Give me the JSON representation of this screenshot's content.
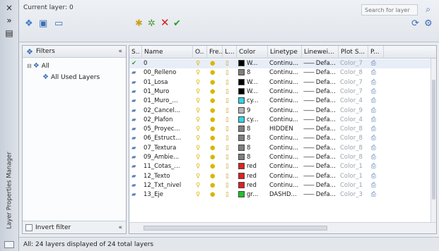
{
  "palette": {
    "title": "Layer Properties Manager"
  },
  "header": {
    "current_layer": "Current layer: 0",
    "search_placeholder": "Search for layer"
  },
  "filters": {
    "title": "Filters",
    "collapse_glyph": "«",
    "tree": [
      {
        "label": "All",
        "level": 0
      },
      {
        "label": "All Used Layers",
        "level": 1
      }
    ],
    "invert_filter_label": "Invert filter",
    "invert_filter_checked": false
  },
  "columns": [
    "S..",
    "Name",
    "O..",
    "Fre...",
    "L...",
    "Color",
    "Linetype",
    "Linewei...",
    "Plot S...",
    "P..."
  ],
  "layers": [
    {
      "name": "0",
      "color_name": "W...",
      "color_hex": "#000000",
      "linetype": "Continu...",
      "lineweight": "Defa...",
      "plot_style": "Color_7",
      "current": true
    },
    {
      "name": "00_Relleno",
      "color_name": "8",
      "color_hex": "#7f7f7f",
      "linetype": "Continu...",
      "lineweight": "Defa...",
      "plot_style": "Color_8",
      "current": false
    },
    {
      "name": "01_Losa",
      "color_name": "W...",
      "color_hex": "#000000",
      "linetype": "Continu...",
      "lineweight": "Defa...",
      "plot_style": "Color_7",
      "current": false
    },
    {
      "name": "01_Muro",
      "color_name": "W...",
      "color_hex": "#000000",
      "linetype": "Continu...",
      "lineweight": "Defa...",
      "plot_style": "Color_7",
      "current": false
    },
    {
      "name": "01_Muro_...",
      "color_name": "cy...",
      "color_hex": "#2fd6e8",
      "linetype": "Continu...",
      "lineweight": "Defa...",
      "plot_style": "Color_4",
      "current": false
    },
    {
      "name": "02_Cancel...",
      "color_name": "9",
      "color_hex": "#b5b5b5",
      "linetype": "Continu...",
      "lineweight": "Defa...",
      "plot_style": "Color_9",
      "current": false
    },
    {
      "name": "02_Plafon",
      "color_name": "cy...",
      "color_hex": "#2fd6e8",
      "linetype": "Continu...",
      "lineweight": "Defa...",
      "plot_style": "Color_4",
      "current": false
    },
    {
      "name": "05_Proyec...",
      "color_name": "8",
      "color_hex": "#7f7f7f",
      "linetype": "HIDDEN",
      "lineweight": "Defa...",
      "plot_style": "Color_8",
      "current": false
    },
    {
      "name": "06_Estruct...",
      "color_name": "8",
      "color_hex": "#7f7f7f",
      "linetype": "Continu...",
      "lineweight": "Defa...",
      "plot_style": "Color_8",
      "current": false
    },
    {
      "name": "07_Textura",
      "color_name": "8",
      "color_hex": "#7f7f7f",
      "linetype": "Continu...",
      "lineweight": "Defa...",
      "plot_style": "Color_8",
      "current": false
    },
    {
      "name": "09_Ambie...",
      "color_name": "8",
      "color_hex": "#7f7f7f",
      "linetype": "Continu...",
      "lineweight": "Defa...",
      "plot_style": "Color_8",
      "current": false
    },
    {
      "name": "11_Cotas_...",
      "color_name": "red",
      "color_hex": "#e02020",
      "linetype": "Continu...",
      "lineweight": "Defa...",
      "plot_style": "Color_1",
      "current": false
    },
    {
      "name": "12_Texto",
      "color_name": "red",
      "color_hex": "#e02020",
      "linetype": "Continu...",
      "lineweight": "Defa...",
      "plot_style": "Color_1",
      "current": false
    },
    {
      "name": "12_Txt_nivel",
      "color_name": "red",
      "color_hex": "#e02020",
      "linetype": "Continu...",
      "lineweight": "Defa...",
      "plot_style": "Color_1",
      "current": false
    },
    {
      "name": "13_Eje",
      "color_name": "gr...",
      "color_hex": "#22c02a",
      "linetype": "DASHD...",
      "lineweight": "Defa...",
      "plot_style": "Color_3",
      "current": false
    }
  ],
  "status": {
    "text": "All: 24 layers displayed of 24 total layers"
  },
  "icons": {
    "close": "×",
    "autohide": "»",
    "properties": "▤",
    "new_property_filter": "new-property-filter-icon",
    "new_group_filter": "new-group-filter-icon",
    "layer_states": "layer-states-icon",
    "new_layer": "new-layer-icon",
    "new_vp_frozen_layer": "new-vp-frozen-layer-icon",
    "delete_layer": "delete-layer-icon",
    "set_current": "set-current-icon",
    "refresh": "refresh-icon",
    "settings": "settings-icon",
    "search": "search-icon"
  }
}
